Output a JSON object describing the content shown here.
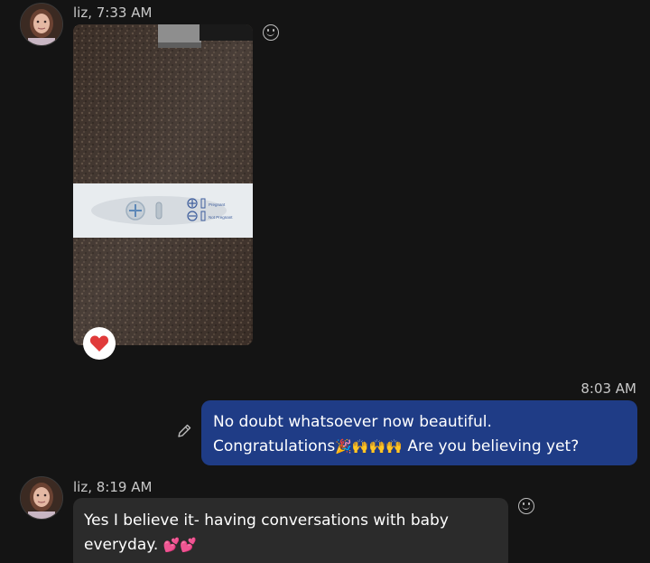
{
  "messages": [
    {
      "sender": "liz",
      "meta": "liz, 7:33 AM",
      "attachment": {
        "type": "photo",
        "test_labels": [
          "Pregnant",
          "Not Pregnant"
        ]
      },
      "reaction_icon": "heart-icon"
    },
    {
      "sender": "me",
      "time": "8:03 AM",
      "line1": "No doubt whatsoever now beautiful.",
      "line2_prefix": "Congratulations",
      "line2_emojis": "🎉🙌🙌🙌",
      "line2_suffix": " Are you believing yet?"
    },
    {
      "sender": "liz",
      "meta": "liz, 8:19 AM",
      "line1": "Yes I believe it- having conversations with baby",
      "line2_text": "everyday. ",
      "line2_emojis": "💕💕"
    }
  ],
  "colors": {
    "background": "#141414",
    "outgoing_bubble": "#1f3c86",
    "incoming_bubble": "#2b2b2b",
    "reaction_heart": "#e03a3a"
  }
}
